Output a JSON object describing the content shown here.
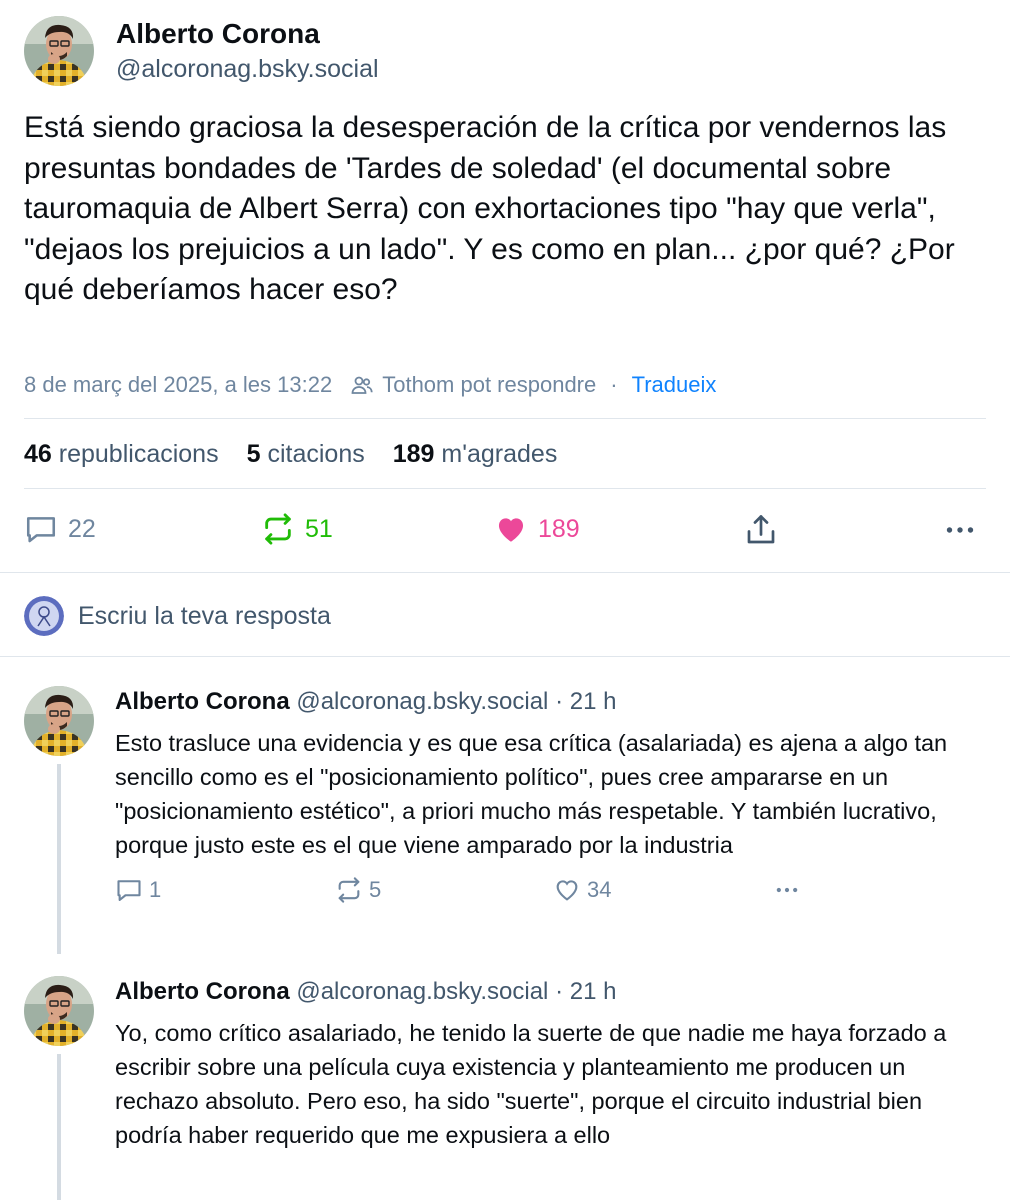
{
  "post": {
    "author_name": "Alberto Corona",
    "author_handle": "@alcoronag.bsky.social",
    "text": "Está siendo graciosa la desesperación de la crítica por vendernos las presuntas bondades de 'Tardes de soledad' (el documental sobre tauromaquia de Albert Serra) con exhortaciones tipo \"hay que verla\", \"dejaos los prejuicios a un lado\". Y es como en plan... ¿por qué? ¿Por qué deberíamos hacer eso?",
    "timestamp": "8 de març del 2025, a les 13:22",
    "reply_permission": "Tothom pot respondre",
    "separator": "·",
    "translate_label": "Tradueix",
    "counts": {
      "reposts_num": "46",
      "reposts_label": "republicacions",
      "quotes_num": "5",
      "quotes_label": "citacions",
      "likes_num": "189",
      "likes_label": "m'agrades"
    },
    "actions": {
      "replies": "22",
      "reposts": "51",
      "likes": "189"
    },
    "icons": [
      "comment-icon",
      "repost-icon",
      "heart-icon",
      "share-icon",
      "more-icon",
      "people-icon"
    ]
  },
  "compose": {
    "placeholder": "Escriu la teva resposta"
  },
  "replies": [
    {
      "author_name": "Alberto Corona",
      "author_handle": "@alcoronag.bsky.social",
      "sep": "·",
      "age": "21 h",
      "text": "Esto trasluce una evidencia y es que esa crítica (asalariada) es ajena a algo tan sencillo como es el \"posicionamiento político\", pues cree ampararse en un \"posicionamiento estético\", a priori mucho más respetable. Y también lucrativo, porque justo este es el que viene amparado por la industria",
      "replies": "1",
      "reposts": "5",
      "likes": "34"
    },
    {
      "author_name": "Alberto Corona",
      "author_handle": "@alcoronag.bsky.social",
      "sep": "·",
      "age": "21 h",
      "text": "Yo, como crítico asalariado, he tenido la suerte de que nadie me haya forzado a escribir sobre una película cuya existencia y planteamiento me producen un rechazo absoluto. Pero eso, ha sido \"suerte\", porque el circuito industrial bien podría haber requerido que me expusiera a ello"
    }
  ],
  "colors": {
    "text": "#0b0f14",
    "muted": "#42576c",
    "meta": "#6f869f",
    "link": "#1083fe",
    "repost_active": "#20bc07",
    "like_active": "#ec4899",
    "divider": "#e0e6ec"
  }
}
